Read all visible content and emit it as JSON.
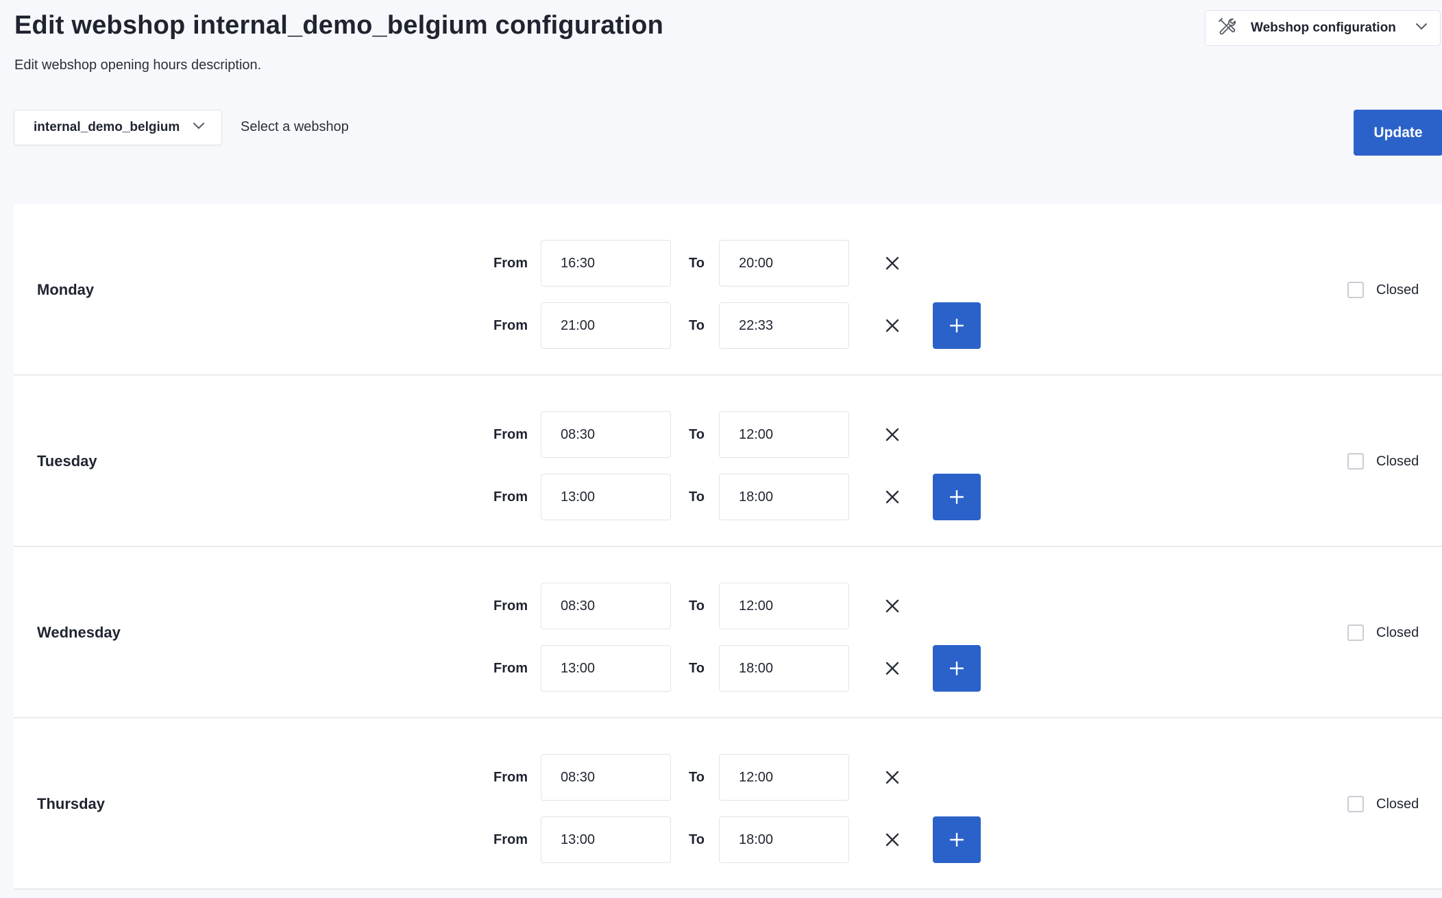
{
  "header": {
    "title": "Edit webshop internal_demo_belgium configuration",
    "subtitle": "Edit webshop opening hours description."
  },
  "config_menu": {
    "icon": "tools-icon",
    "label": "Webshop configuration"
  },
  "webshop_select": {
    "value": "internal_demo_belgium",
    "hint": "Select a webshop"
  },
  "update_label": "Update",
  "labels": {
    "from": "From",
    "to": "To",
    "closed": "Closed"
  },
  "colors": {
    "primary": "#2b62c9"
  },
  "days": [
    {
      "name": "Monday",
      "closed": false,
      "slots": [
        {
          "from": "16:30",
          "to": "20:00"
        },
        {
          "from": "21:00",
          "to": "22:33"
        }
      ]
    },
    {
      "name": "Tuesday",
      "closed": false,
      "slots": [
        {
          "from": "08:30",
          "to": "12:00"
        },
        {
          "from": "13:00",
          "to": "18:00"
        }
      ]
    },
    {
      "name": "Wednesday",
      "closed": false,
      "slots": [
        {
          "from": "08:30",
          "to": "12:00"
        },
        {
          "from": "13:00",
          "to": "18:00"
        }
      ]
    },
    {
      "name": "Thursday",
      "closed": false,
      "slots": [
        {
          "from": "08:30",
          "to": "12:00"
        },
        {
          "from": "13:00",
          "to": "18:00"
        }
      ]
    }
  ]
}
